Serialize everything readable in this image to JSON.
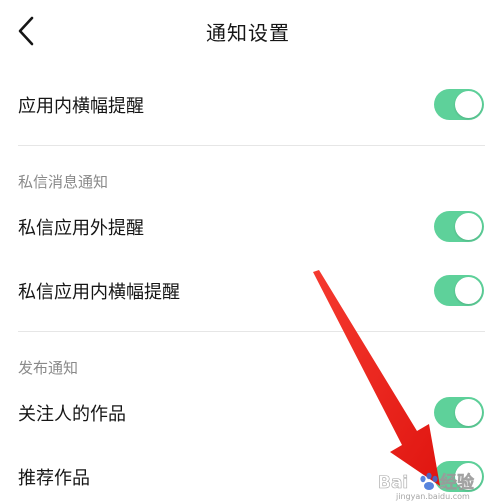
{
  "header": {
    "title": "通知设置",
    "back_icon": "chevron-left-icon"
  },
  "rows": {
    "in_app_banner": {
      "label": "应用内横幅提醒",
      "enabled": true
    },
    "dm_section_title": "私信消息通知",
    "dm_out_app": {
      "label": "私信应用外提醒",
      "enabled": true
    },
    "dm_in_app_banner": {
      "label": "私信应用内横幅提醒",
      "enabled": true
    },
    "publish_section_title": "发布通知",
    "followed_works": {
      "label": "关注人的作品",
      "enabled": true
    },
    "recommended_works": {
      "label": "推荐作品",
      "enabled": true
    }
  },
  "colors": {
    "toggle_on": "#5ed19a",
    "arrow": "#f0241d",
    "section_text": "#8a8a8a",
    "divider": "#e6e6e6"
  },
  "watermark": {
    "text": "Bai经验",
    "url": "jingyan.baidu.com"
  }
}
